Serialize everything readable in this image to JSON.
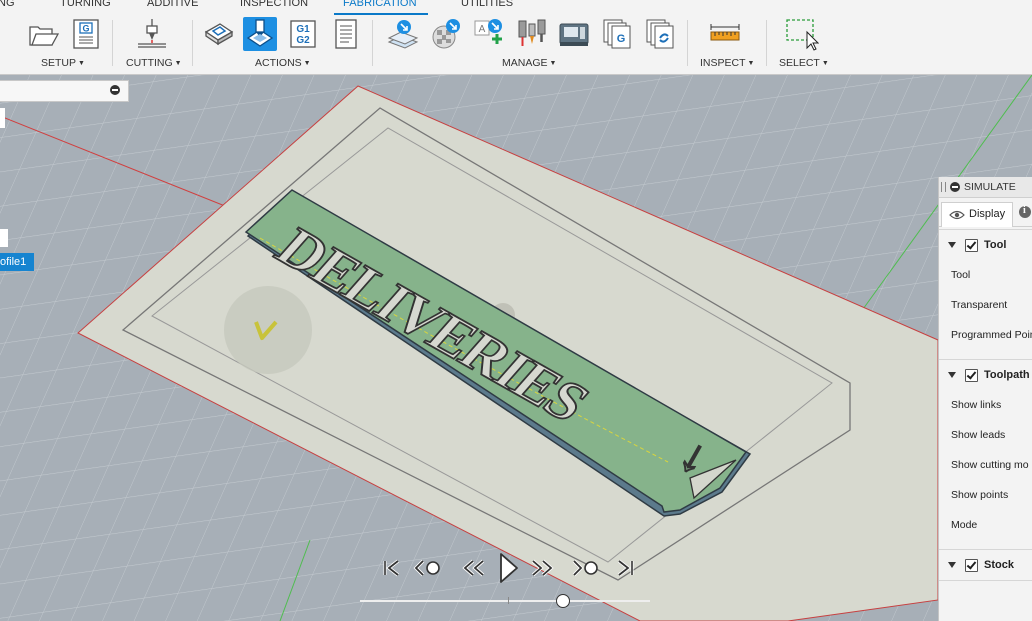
{
  "tabs": [
    {
      "label": "NG",
      "active": false
    },
    {
      "label": "TURNING",
      "active": false
    },
    {
      "label": "ADDITIVE",
      "active": false
    },
    {
      "label": "INSPECTION",
      "active": false
    },
    {
      "label": "FABRICATION",
      "active": true
    },
    {
      "label": "UTILITIES",
      "active": false
    }
  ],
  "groups": {
    "setup": "SETUP",
    "cutting": "CUTTING",
    "actions": "ACTIONS",
    "manage": "MANAGE",
    "inspect": "INSPECT",
    "select": "SELECT"
  },
  "buttons": {
    "gcode_label": "G1\nG2",
    "nc_program_letter": "G",
    "template_letter": "A"
  },
  "browser": {
    "profile_item": "ofile1"
  },
  "simulate": {
    "title": "SIMULATE",
    "display_tab": "Display",
    "sections": [
      {
        "title": "Tool",
        "checked": true,
        "rows": [
          "Tool",
          "Transparent",
          "Programmed Poin"
        ]
      },
      {
        "title": "Toolpath",
        "checked": true,
        "rows": [
          "Show links",
          "Show leads",
          "Show cutting mo",
          "Show points",
          "Mode"
        ]
      },
      {
        "title": "Stock",
        "checked": true,
        "rows": []
      }
    ]
  },
  "part": {
    "engraved_text": "DELIVERIES"
  },
  "playback": {
    "position": 0.7
  },
  "colors": {
    "accent": "#1d8fe2",
    "tab_active": "#0a79c8",
    "part_green": "#86b38b",
    "stock_sheet": "#d9dbd2",
    "viewport_bg": "#a7afb7"
  }
}
